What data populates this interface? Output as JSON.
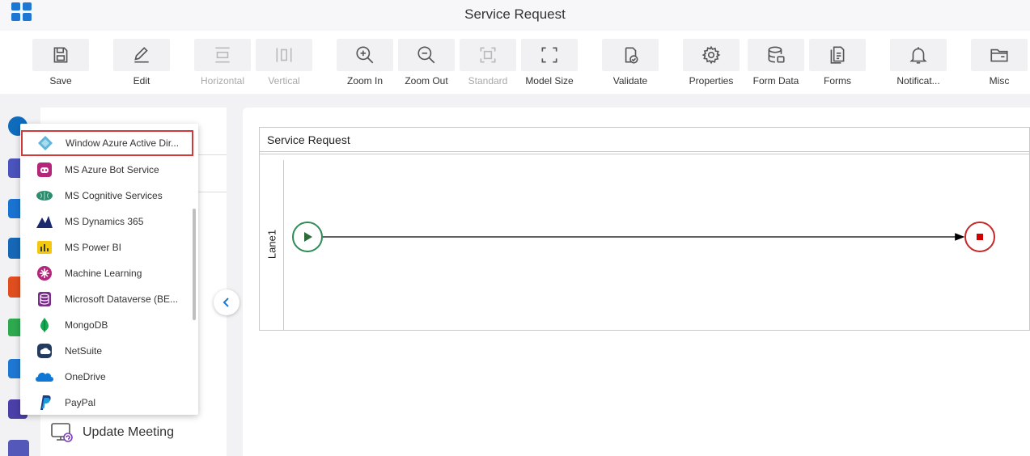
{
  "app": {
    "title": "Service Request"
  },
  "toolbar": {
    "buttons": [
      {
        "label": "Save",
        "icon": "save-icon",
        "enabled": true
      },
      {
        "label": "Edit",
        "icon": "edit-icon",
        "enabled": true
      },
      {
        "label": "Horizontal",
        "icon": "horizontal-icon",
        "enabled": false
      },
      {
        "label": "Vertical",
        "icon": "vertical-icon",
        "enabled": false
      },
      {
        "label": "Zoom In",
        "icon": "zoom-in-icon",
        "enabled": true
      },
      {
        "label": "Zoom Out",
        "icon": "zoom-out-icon",
        "enabled": true
      },
      {
        "label": "Standard",
        "icon": "standard-icon",
        "enabled": false
      },
      {
        "label": "Model Size",
        "icon": "model-size-icon",
        "enabled": true
      },
      {
        "label": "Validate",
        "icon": "validate-icon",
        "enabled": true
      },
      {
        "label": "Properties",
        "icon": "gear-icon",
        "enabled": true
      },
      {
        "label": "Form Data",
        "icon": "database-icon",
        "enabled": true
      },
      {
        "label": "Forms",
        "icon": "forms-icon",
        "enabled": true
      },
      {
        "label": "Notificat...",
        "icon": "bell-icon",
        "enabled": true
      },
      {
        "label": "Misc",
        "icon": "folder-icon",
        "enabled": true
      }
    ]
  },
  "dropdown": {
    "items": [
      {
        "label": "Window Azure Active Dir...",
        "icon": "azure-ad-icon",
        "selected": true
      },
      {
        "label": "MS Azure Bot Service",
        "icon": "bot-icon"
      },
      {
        "label": "MS Cognitive Services",
        "icon": "brain-icon"
      },
      {
        "label": "MS Dynamics 365",
        "icon": "dynamics-icon"
      },
      {
        "label": "MS Power BI",
        "icon": "power-bi-icon"
      },
      {
        "label": "Machine Learning",
        "icon": "machine-learning-icon"
      },
      {
        "label": "Microsoft Dataverse (BE...",
        "icon": "dataverse-icon"
      },
      {
        "label": "MongoDB",
        "icon": "mongodb-icon"
      },
      {
        "label": "NetSuite",
        "icon": "netsuite-icon"
      },
      {
        "label": "OneDrive",
        "icon": "onedrive-icon"
      },
      {
        "label": "PayPal",
        "icon": "paypal-icon"
      }
    ]
  },
  "panel": {
    "update_meeting_label": "Update Meeting"
  },
  "canvas": {
    "pool_name": "Service Request",
    "lane_name": "Lane1"
  },
  "colors": {
    "accent": "#1e77d3",
    "start_event": "#2e8b57",
    "end_event": "#c62828",
    "selection_outline": "#d23a3a"
  }
}
